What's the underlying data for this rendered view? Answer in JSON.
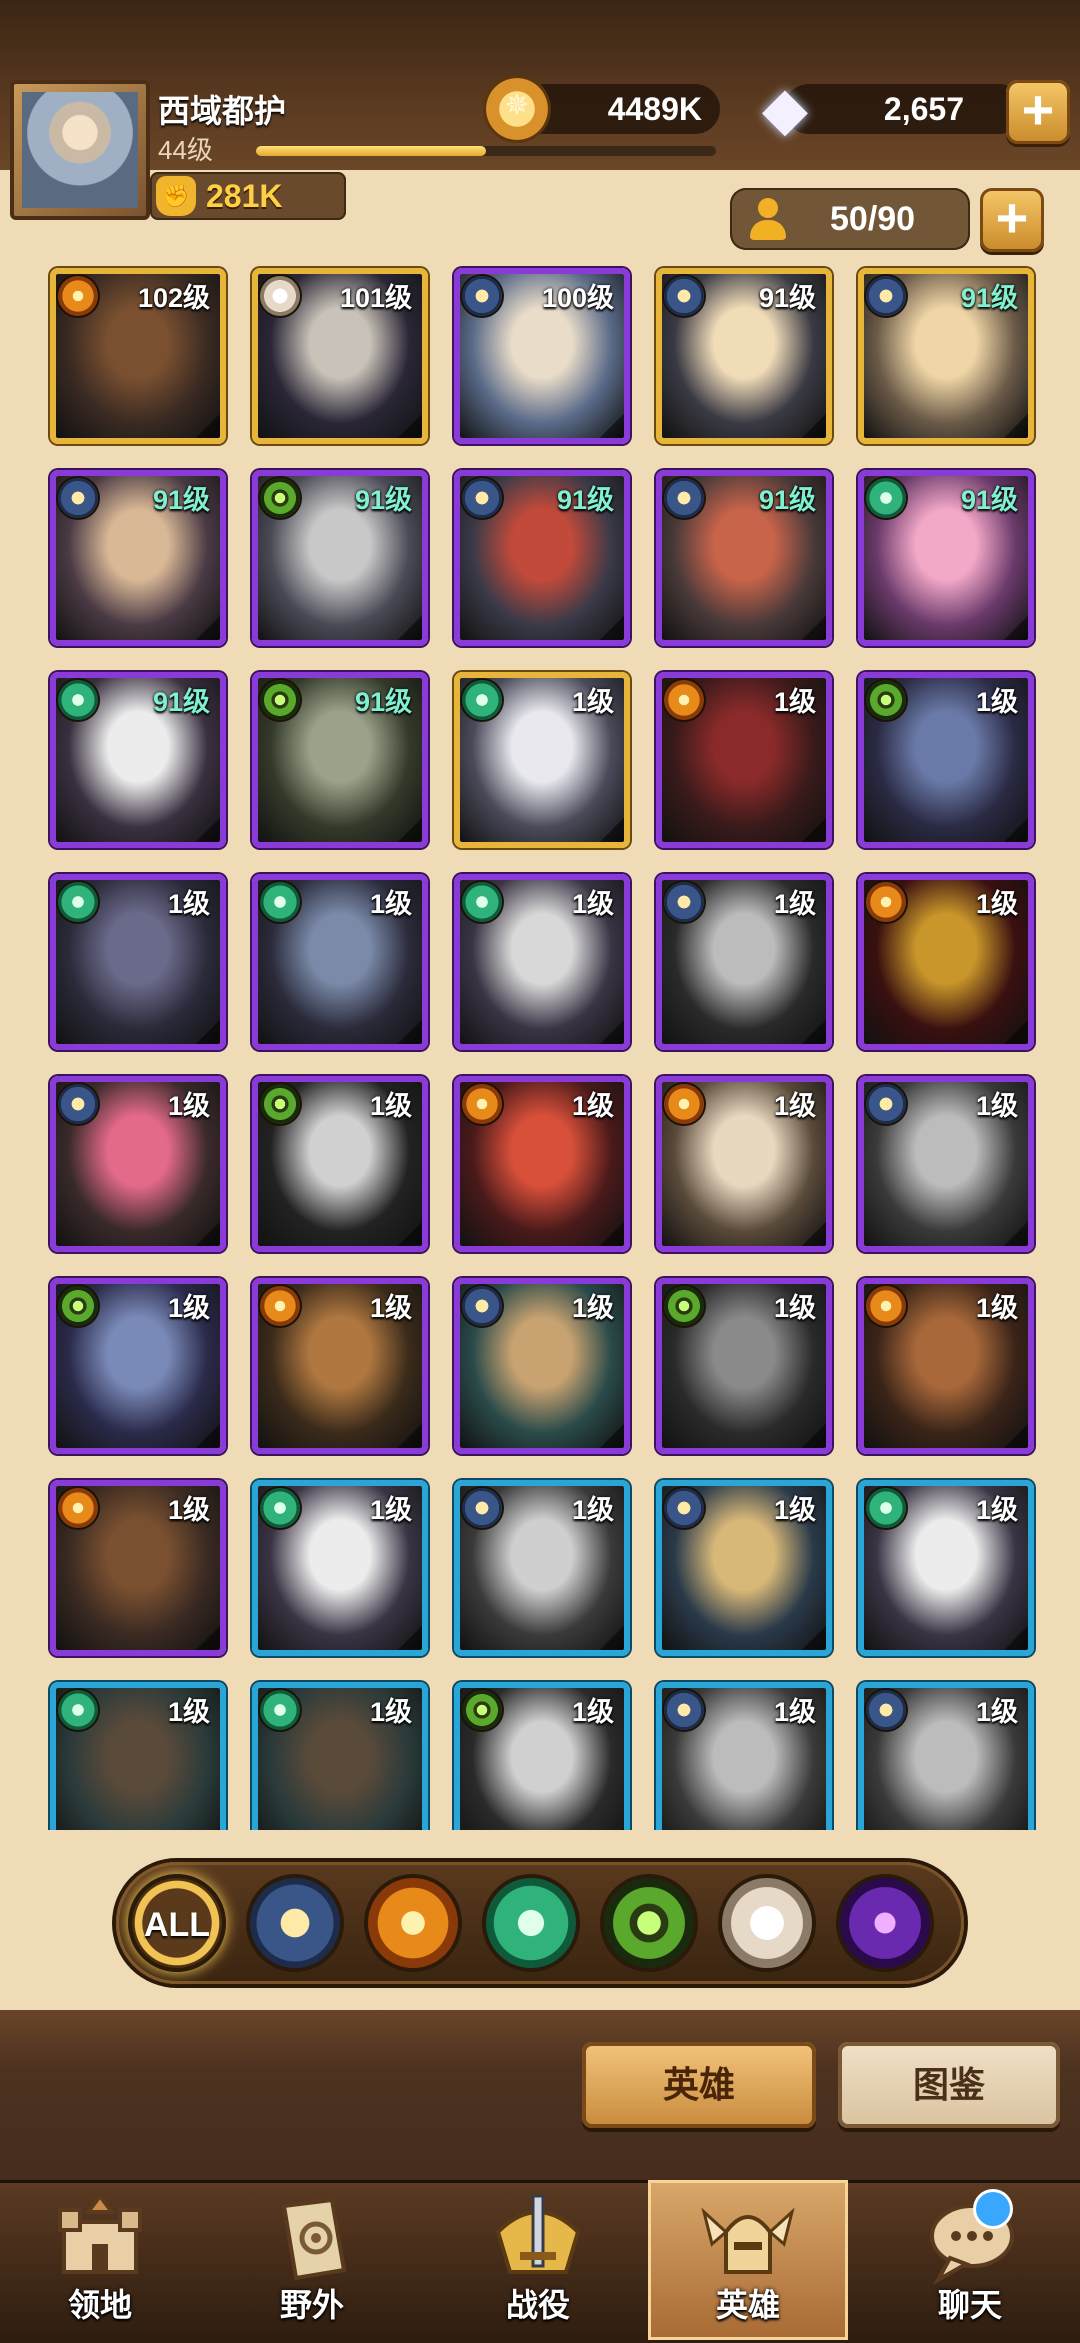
{
  "player": {
    "name": "西域都护",
    "level": "44级",
    "xp_progress": 0.5,
    "power": "281K"
  },
  "resources": {
    "gold": "4489K",
    "diamonds": "2,657"
  },
  "roster": {
    "count": "50/90"
  },
  "heroes": [
    {
      "level": "102级",
      "faction": "mauler",
      "rarity": "gold",
      "teal": false
    },
    {
      "level": "101级",
      "faction": "celestial",
      "rarity": "gold",
      "teal": false
    },
    {
      "level": "100级",
      "faction": "lightbearer",
      "rarity": "purple",
      "teal": false
    },
    {
      "level": "91级",
      "faction": "lightbearer",
      "rarity": "gold",
      "teal": false
    },
    {
      "level": "91级",
      "faction": "lightbearer",
      "rarity": "gold",
      "teal": true
    },
    {
      "level": "91级",
      "faction": "lightbearer",
      "rarity": "purple",
      "teal": true
    },
    {
      "level": "91级",
      "faction": "graveborn",
      "rarity": "purple",
      "teal": true
    },
    {
      "level": "91级",
      "faction": "lightbearer",
      "rarity": "purple",
      "teal": true
    },
    {
      "level": "91级",
      "faction": "lightbearer",
      "rarity": "purple",
      "teal": true
    },
    {
      "level": "91级",
      "faction": "wilder",
      "rarity": "purple",
      "teal": true
    },
    {
      "level": "91级",
      "faction": "wilder",
      "rarity": "purple",
      "teal": true
    },
    {
      "level": "91级",
      "faction": "graveborn",
      "rarity": "purple",
      "teal": true
    },
    {
      "level": "1级",
      "faction": "wilder",
      "rarity": "gold",
      "teal": false
    },
    {
      "level": "1级",
      "faction": "mauler",
      "rarity": "purple",
      "teal": false
    },
    {
      "level": "1级",
      "faction": "graveborn",
      "rarity": "purple",
      "teal": false
    },
    {
      "level": "1级",
      "faction": "wilder",
      "rarity": "purple",
      "teal": false
    },
    {
      "level": "1级",
      "faction": "wilder",
      "rarity": "purple",
      "teal": false
    },
    {
      "level": "1级",
      "faction": "wilder",
      "rarity": "purple",
      "teal": false
    },
    {
      "level": "1级",
      "faction": "lightbearer",
      "rarity": "purple",
      "teal": false
    },
    {
      "level": "1级",
      "faction": "mauler",
      "rarity": "purple",
      "teal": false
    },
    {
      "level": "1级",
      "faction": "lightbearer",
      "rarity": "purple",
      "teal": false
    },
    {
      "level": "1级",
      "faction": "graveborn",
      "rarity": "purple",
      "teal": false
    },
    {
      "level": "1级",
      "faction": "mauler",
      "rarity": "purple",
      "teal": false
    },
    {
      "level": "1级",
      "faction": "mauler",
      "rarity": "purple",
      "teal": false
    },
    {
      "level": "1级",
      "faction": "lightbearer",
      "rarity": "purple",
      "teal": false
    },
    {
      "level": "1级",
      "faction": "graveborn",
      "rarity": "purple",
      "teal": false
    },
    {
      "level": "1级",
      "faction": "mauler",
      "rarity": "purple",
      "teal": false
    },
    {
      "level": "1级",
      "faction": "lightbearer",
      "rarity": "purple",
      "teal": false
    },
    {
      "level": "1级",
      "faction": "graveborn",
      "rarity": "purple",
      "teal": false
    },
    {
      "level": "1级",
      "faction": "mauler",
      "rarity": "purple",
      "teal": false
    },
    {
      "level": "1级",
      "faction": "mauler",
      "rarity": "purple",
      "teal": false
    },
    {
      "level": "1级",
      "faction": "wilder",
      "rarity": "blue",
      "teal": false
    },
    {
      "level": "1级",
      "faction": "lightbearer",
      "rarity": "blue",
      "teal": false
    },
    {
      "level": "1级",
      "faction": "lightbearer",
      "rarity": "blue",
      "teal": false
    },
    {
      "level": "1级",
      "faction": "wilder",
      "rarity": "blue",
      "teal": false
    },
    {
      "level": "1级",
      "faction": "wilder",
      "rarity": "blue",
      "teal": false
    },
    {
      "level": "1级",
      "faction": "wilder",
      "rarity": "blue",
      "teal": false
    },
    {
      "level": "1级",
      "faction": "graveborn",
      "rarity": "blue",
      "teal": false
    },
    {
      "level": "1级",
      "faction": "lightbearer",
      "rarity": "blue",
      "teal": false
    },
    {
      "level": "1级",
      "faction": "lightbearer",
      "rarity": "blue",
      "teal": false
    }
  ],
  "filters": {
    "all_label": "ALL"
  },
  "tabs": {
    "heroes": "英雄",
    "atlas": "图鉴"
  },
  "nav": {
    "territory": "领地",
    "outside": "野外",
    "campaign": "战役",
    "heroes": "英雄",
    "chat": "聊天"
  }
}
